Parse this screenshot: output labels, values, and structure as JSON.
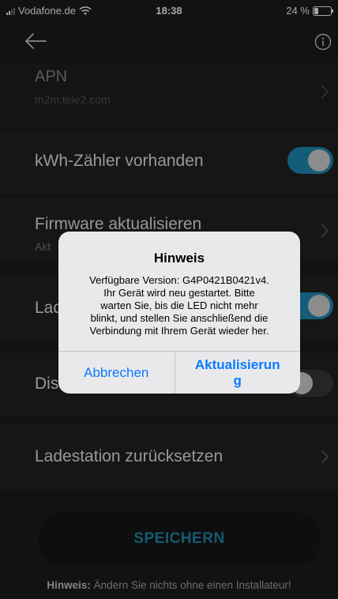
{
  "status_bar": {
    "carrier": "Vodafone.de",
    "time": "18:38",
    "battery": "24 %"
  },
  "settings": {
    "apn": {
      "title": "APN",
      "value": "m2m.tele2.com"
    },
    "kwh_meter": {
      "title": "kWh-Zähler vorhanden",
      "enabled": true
    },
    "firmware": {
      "title": "Firmware aktualisieren",
      "subtitle": "Akt"
    },
    "charging": {
      "title": "Lad",
      "enabled": true
    },
    "display": {
      "title": "Dis",
      "enabled": false
    },
    "reset": {
      "title": "Ladestation zurücksetzen"
    }
  },
  "save_button": {
    "label": "SPEICHERN"
  },
  "hint": {
    "label": "Hinweis:",
    "text": " Ändern Sie nichts ohne einen Installateur!"
  },
  "alert": {
    "title": "Hinweis",
    "message_lines": [
      "Verfügbare Version: G4P0421B0421v4.",
      "Ihr Gerät wird neu gestartet. Bitte",
      "warten Sie, bis die LED nicht mehr",
      "blinkt, und stellen Sie anschließend die",
      "Verbindung mit Ihrem Gerät wieder her."
    ],
    "cancel_label": "Abbrechen",
    "confirm_label_line1": "Aktualisierun",
    "confirm_label_line2": "g"
  },
  "colors": {
    "accent": "#1f8bb0",
    "toggle_on": "#1e90b8",
    "ios_blue": "#0a7aff",
    "background": "#1c1c1c"
  },
  "icons": [
    "back-arrow-icon",
    "info-icon",
    "chevron-right-icon",
    "wifi-icon",
    "signal-icon",
    "battery-icon"
  ]
}
